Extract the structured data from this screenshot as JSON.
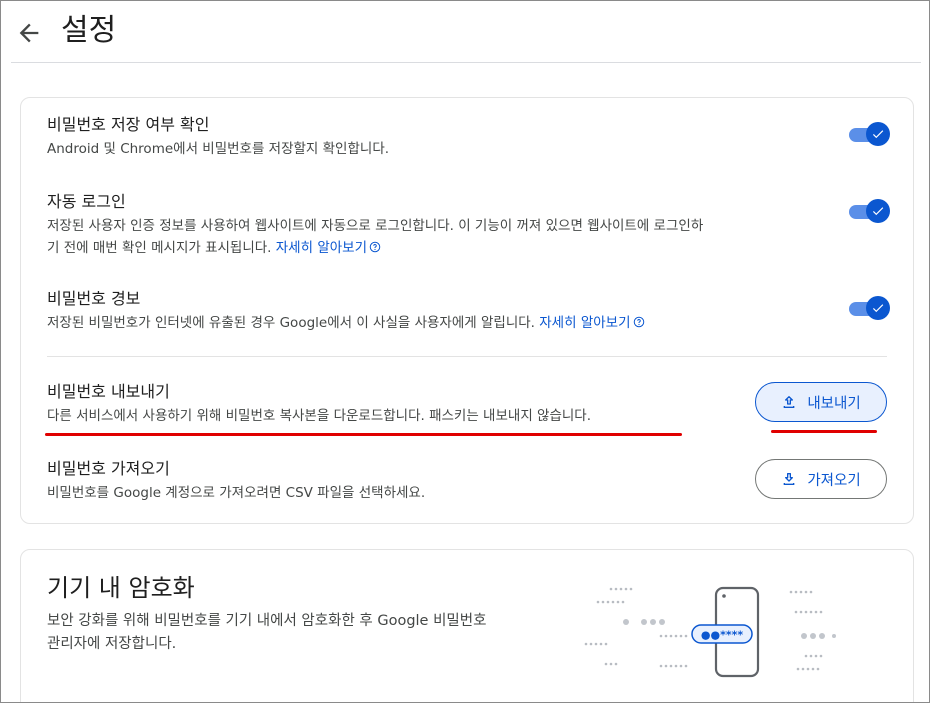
{
  "header": {
    "title": "설정"
  },
  "settings": {
    "save_check": {
      "title": "비밀번호 저장 여부 확인",
      "desc": "Android 및 Chrome에서 비밀번호를 저장할지 확인합니다.",
      "enabled": true
    },
    "auto_login": {
      "title": "자동 로그인",
      "desc_line1": "저장된 사용자 인증 정보를 사용하여 웹사이트에 자동으로 로그인합니다. 이 기능이 꺼져 있으면 웹사이트에 로그인하",
      "desc_line2": "기 전에 매번 확인 메시지가 표시됩니다.",
      "link": "자세히 알아보기",
      "enabled": true
    },
    "password_alert": {
      "title": "비밀번호 경보",
      "desc": "저장된 비밀번호가 인터넷에 유출된 경우 Google에서 이 사실을 사용자에게 알립니다.",
      "link": "자세히 알아보기",
      "enabled": true
    },
    "export": {
      "title": "비밀번호 내보내기",
      "desc": "다른 서비스에서 사용하기 위해 비밀번호 복사본을 다운로드합니다. 패스키는 내보내지 않습니다.",
      "button": "내보내기"
    },
    "import": {
      "title": "비밀번호 가져오기",
      "desc": "비밀번호를 Google 계정으로 가져오려면 CSV 파일을 선택하세요.",
      "button": "가져오기"
    }
  },
  "encryption": {
    "title": "기기 내 암호화",
    "desc_line1": "보안 강화를 위해 비밀번호를 기기 내에서 암호화한 후 Google 비밀번호",
    "desc_line2": "관리자에 저장합니다.",
    "illustration_text": "●●****"
  },
  "colors": {
    "accent": "#0b57d0",
    "toggle_track": "#5b8fe8",
    "annotation_red": "#e00000"
  },
  "icons": {
    "back": "arrow-left-icon",
    "help": "help-circle-icon",
    "check": "check-icon",
    "upload": "upload-icon",
    "download": "download-icon"
  }
}
